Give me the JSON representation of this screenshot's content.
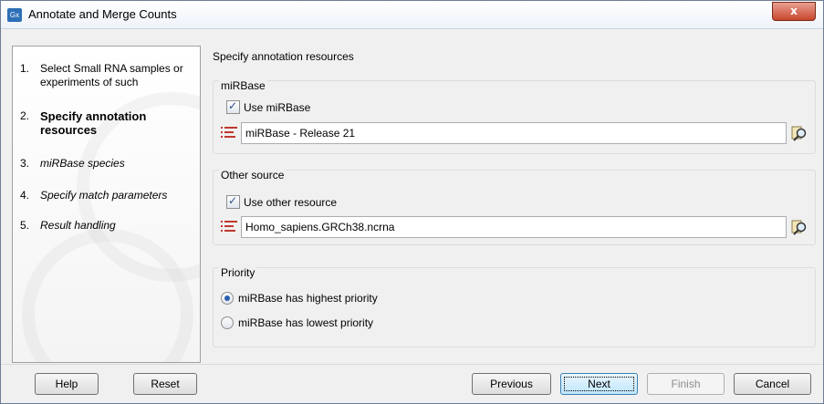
{
  "window": {
    "title": "Annotate and Merge Counts",
    "app_icon": "Gx",
    "close_label": "x"
  },
  "steps": [
    {
      "num": "1.",
      "label": "Select Small RNA samples or experiments of such",
      "state": "done"
    },
    {
      "num": "2.",
      "label": "Specify annotation resources",
      "state": "active"
    },
    {
      "num": "3.",
      "label": "miRBase species",
      "state": "future"
    },
    {
      "num": "4.",
      "label": "Specify match parameters",
      "state": "future"
    },
    {
      "num": "5.",
      "label": "Result handling",
      "state": "future"
    }
  ],
  "main": {
    "heading": "Specify annotation resources",
    "mirbase": {
      "title": "miRBase",
      "checkbox_label": "Use miRBase",
      "checked": true,
      "resource_value": "miRBase - Release 21"
    },
    "other": {
      "title": "Other source",
      "checkbox_label": "Use other resource",
      "checked": true,
      "resource_value": "Homo_sapiens.GRCh38.ncrna"
    },
    "priority": {
      "title": "Priority",
      "options": [
        {
          "label": "miRBase has highest priority",
          "selected": true
        },
        {
          "label": "miRBase has lowest priority",
          "selected": false
        }
      ]
    }
  },
  "buttons": {
    "help": "Help",
    "reset": "Reset",
    "previous": "Previous",
    "next": "Next",
    "finish": "Finish",
    "cancel": "Cancel"
  },
  "colors": {
    "list_icon": "#c0392b",
    "radio_dot": "#2a5fb0",
    "close_button": "#c9462c"
  }
}
